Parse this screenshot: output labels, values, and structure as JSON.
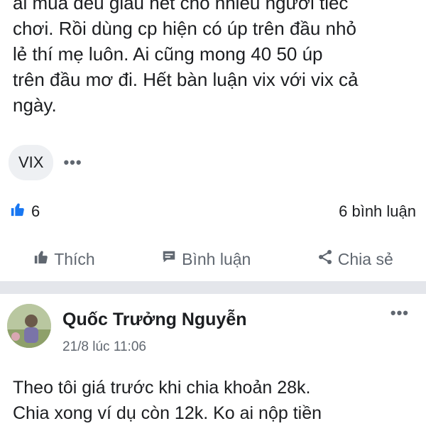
{
  "post": {
    "lines": [
      "ai mua đều giàu hết cho nhiều người tiếc",
      "chơi. Rồi dùng cp hiện có úp trên đầu nhỏ",
      "lẻ thí mẹ luôn. Ai cũng mong 40 50 úp",
      "trên đầu mơ đi. Hết bàn luận vix với vix cả",
      "ngày."
    ],
    "tag": "VIX",
    "more": "•••",
    "like_count": "6",
    "comment_count_label": "6 bình luận"
  },
  "actions": {
    "like": "Thích",
    "comment": "Bình luận",
    "share": "Chia sẻ"
  },
  "comment": {
    "author": "Quốc Trưởng Nguyễn",
    "time": "21/8 lúc 11:06",
    "more": "•••",
    "lines": [
      "Theo tôi giá trước khi chia khoản 28k.",
      "Chia xong ví dụ còn 12k. Ko ai nộp tiền"
    ]
  },
  "colors": {
    "like_blue": "#1877f2",
    "text": "#1c1e21",
    "secondary": "#606770",
    "divider": "#e4e6eb"
  }
}
